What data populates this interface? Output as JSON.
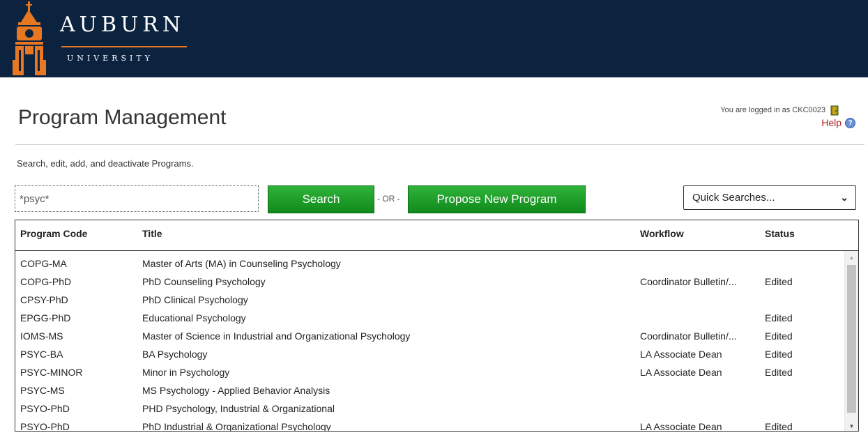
{
  "header": {
    "brand": "AUBURN",
    "brand_sub": "UNIVERSITY",
    "logo_icon": "bell-tower-logo-icon",
    "colors": {
      "navy": "#0c2340",
      "orange": "#e87722"
    }
  },
  "page": {
    "title": "Program Management",
    "description": "Search, edit, add, and deactivate Programs."
  },
  "user": {
    "login_text": "You are logged in as CKC0023",
    "logout_icon": "logout-door-icon",
    "help_label": "Help",
    "help_icon": "help-question-icon"
  },
  "search": {
    "value": "*psyc*",
    "search_label": "Search",
    "or_label": "- OR -",
    "propose_label": "Propose New Program",
    "quick_label": "Quick Searches...",
    "button_color": "#1a9f26"
  },
  "table": {
    "columns": {
      "code": "Program Code",
      "title": "Title",
      "workflow": "Workflow",
      "status": "Status"
    },
    "rows": [
      {
        "code": "COPG-MA",
        "title": "Master of Arts (MA) in Counseling Psychology",
        "workflow": "",
        "status": ""
      },
      {
        "code": "COPG-PhD",
        "title": "PhD Counseling Psychology",
        "workflow": "Coordinator Bulletin/...",
        "status": "Edited"
      },
      {
        "code": "CPSY-PhD",
        "title": "PhD Clinical Psychology",
        "workflow": "",
        "status": ""
      },
      {
        "code": "EPGG-PhD",
        "title": "Educational Psychology",
        "workflow": "",
        "status": "Edited"
      },
      {
        "code": "IOMS-MS",
        "title": "Master of Science in Industrial and Organizational Psychology",
        "workflow": "Coordinator Bulletin/...",
        "status": "Edited"
      },
      {
        "code": "PSYC-BA",
        "title": "BA Psychology",
        "workflow": "LA Associate Dean",
        "status": "Edited"
      },
      {
        "code": "PSYC-MINOR",
        "title": "Minor in Psychology",
        "workflow": "LA Associate Dean",
        "status": "Edited"
      },
      {
        "code": "PSYC-MS",
        "title": "MS Psychology - Applied Behavior Analysis",
        "workflow": "",
        "status": ""
      },
      {
        "code": "PSYO-PhD",
        "title": "PHD Psychology, Industrial & Organizational",
        "workflow": "",
        "status": ""
      },
      {
        "code": "PSYO-PhD",
        "title": "PhD Industrial & Organizational Psychology",
        "workflow": "LA Associate Dean",
        "status": "Edited"
      }
    ]
  }
}
